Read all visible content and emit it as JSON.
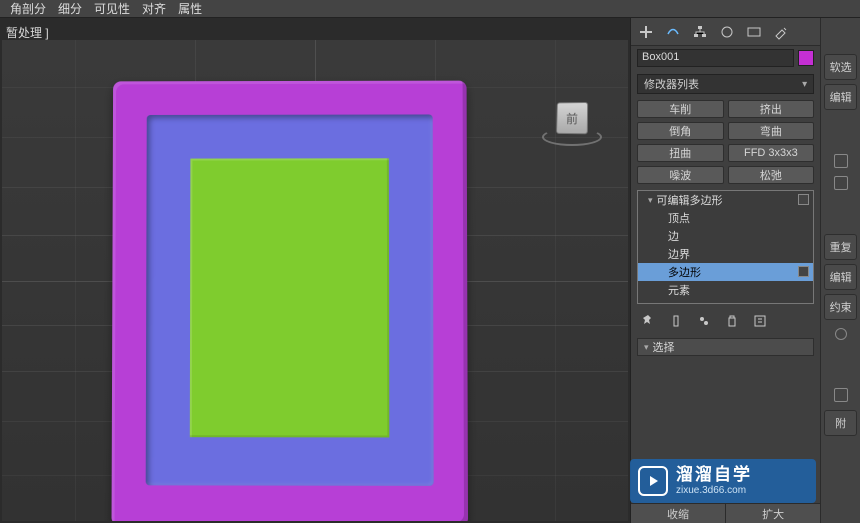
{
  "menubar": {
    "items": [
      "角剖分",
      "细分",
      "可见性",
      "对齐",
      "属性"
    ]
  },
  "viewport": {
    "label": "暂处理 ]",
    "cube_face": "前"
  },
  "panel": {
    "object_name": "Box001",
    "object_color": "#c52fd4",
    "modifier_list_label": "修改器列表",
    "buttons": {
      "lathe": "车削",
      "extrude": "挤出",
      "chamfer": "倒角",
      "bend": "弯曲",
      "twist": "扭曲",
      "ffd": "FFD 3x3x3",
      "noise": "噪波",
      "relax": "松弛"
    },
    "stack": {
      "root": "可编辑多边形",
      "children": [
        "顶点",
        "边",
        "边界",
        "多边形",
        "元素"
      ],
      "selected_index": 3
    },
    "rollout_select": "选择",
    "bottom": {
      "shrink": "收缩",
      "grow": "扩大"
    },
    "side": {
      "soft": "软选",
      "edit": "编辑",
      "undo": "重复",
      "edit2": "编辑",
      "constrain": "约束",
      "attach": "附"
    }
  },
  "watermark": {
    "title": "溜溜自学",
    "url": "zixue.3d66.com"
  }
}
